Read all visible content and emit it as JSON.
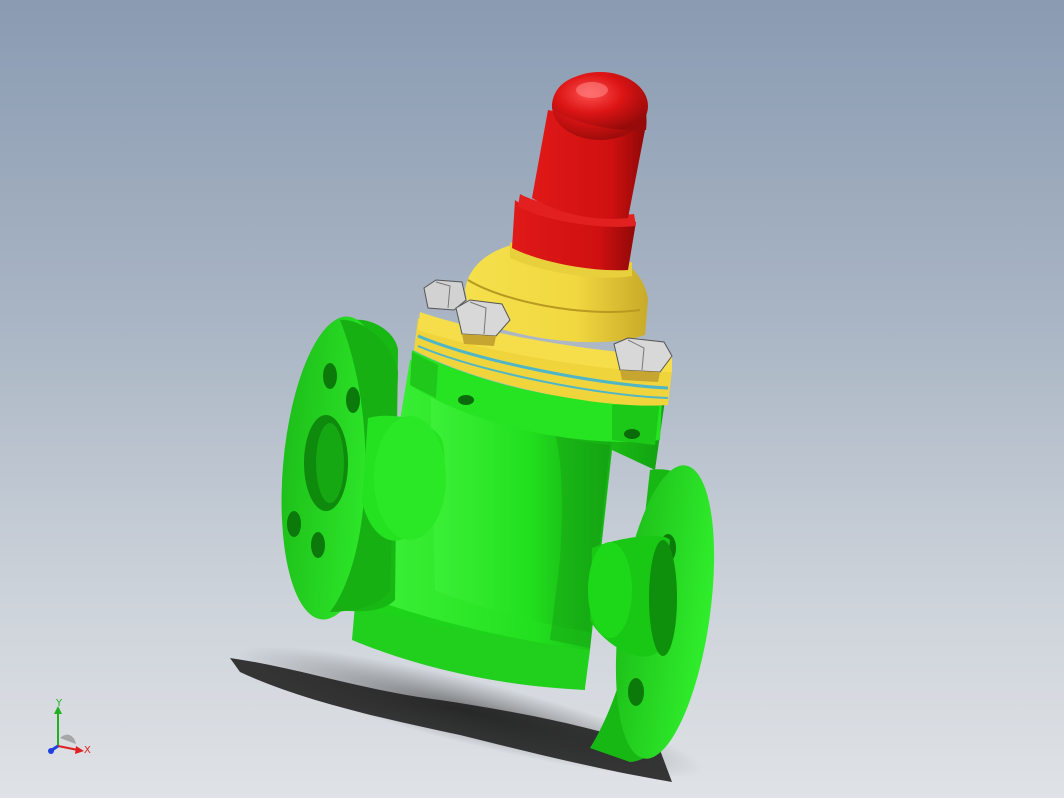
{
  "viewport": {
    "background_top": "#8a9bb2",
    "background_bottom": "#dfe2e6"
  },
  "model": {
    "body_color": "#22e61e",
    "bonnet_color": "#f0dc46",
    "cap_color": "#dc1414",
    "bolt_color": "#c8c8c8",
    "gasket_color": "#4fb6c8"
  },
  "triad": {
    "x_label": "X",
    "y_label": "Y",
    "x_color": "#e02020",
    "y_color": "#20b020",
    "z_color": "#2040e0"
  }
}
